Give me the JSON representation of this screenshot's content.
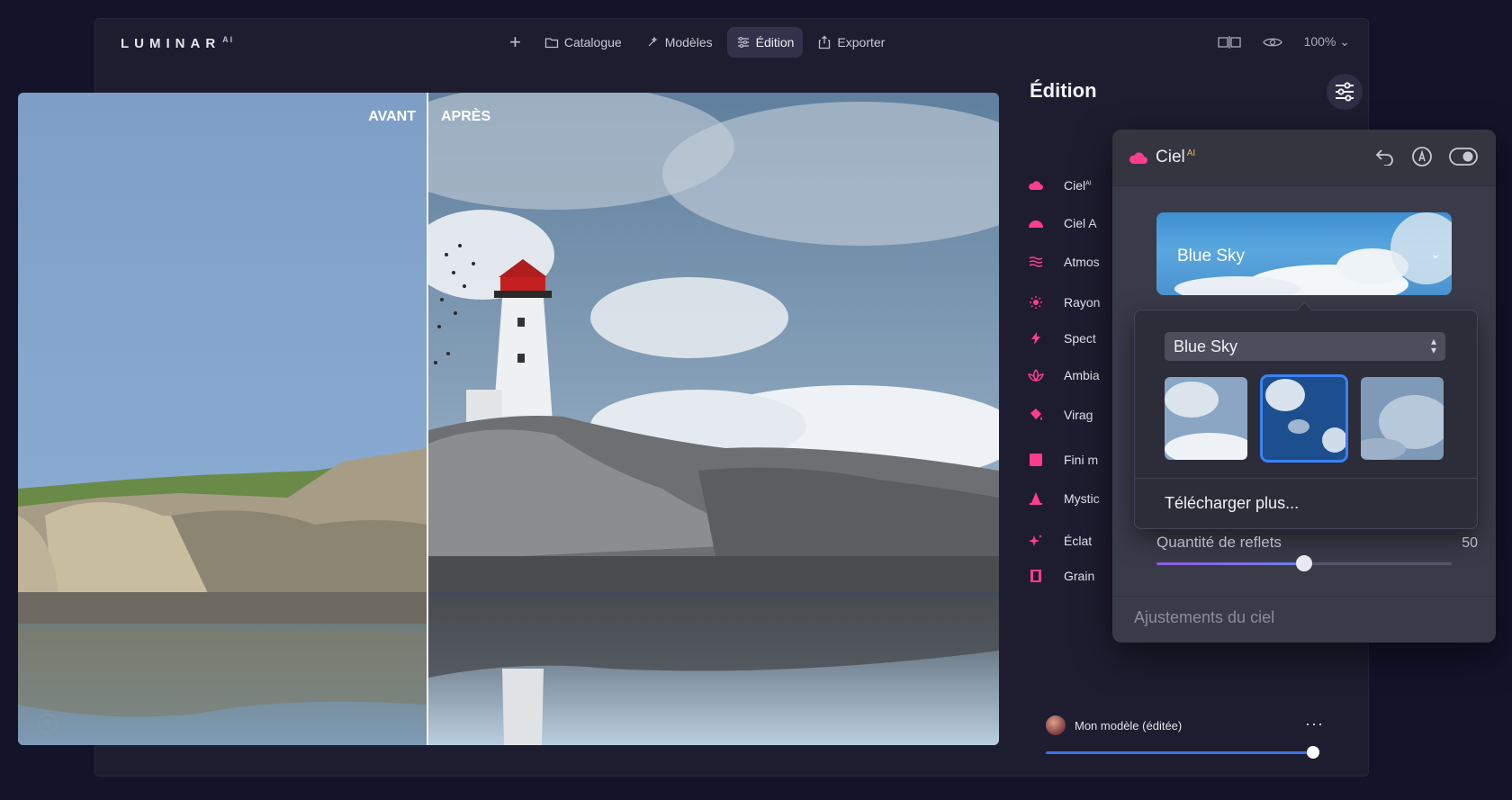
{
  "app": {
    "logo": "LUMINAR",
    "logo_sup": "AI"
  },
  "nav": {
    "plus": "+",
    "items": [
      {
        "label": "Catalogue",
        "icon": "folder-icon",
        "active": false
      },
      {
        "label": "Modèles",
        "icon": "sparkle-icon",
        "active": false
      },
      {
        "label": "Édition",
        "icon": "sliders-icon",
        "active": true
      },
      {
        "label": "Exporter",
        "icon": "export-icon",
        "active": false
      }
    ]
  },
  "toolbar_right": {
    "zoom": "100%"
  },
  "canvas": {
    "before_label": "AVANT",
    "after_label": "APRÈS",
    "copyright_icon": "©"
  },
  "panel": {
    "title": "Édition"
  },
  "tools": [
    {
      "label": "Ciel",
      "sup": "AI",
      "icon": "cloud-icon",
      "color": "#ff3d8f"
    },
    {
      "label": "Ciel A",
      "icon": "half-circle-icon",
      "color": "#ff3d8f"
    },
    {
      "label": "Atmos",
      "icon": "waves-icon",
      "color": "#ff3d8f"
    },
    {
      "label": "Rayon",
      "icon": "sun-icon",
      "color": "#ff3d8f"
    },
    {
      "label": "Spect",
      "icon": "bolt-icon",
      "color": "#ff3d8f"
    },
    {
      "label": "Ambia",
      "icon": "lotus-icon",
      "color": "#ff3d8f"
    },
    {
      "label": "Virag",
      "icon": "paint-bucket-icon",
      "color": "#ff3d8f"
    },
    {
      "label": "Fini m",
      "icon": "square-icon",
      "color": "#ff3d8f"
    },
    {
      "label": "Mystic",
      "icon": "cone-icon",
      "color": "#ff3d8f"
    },
    {
      "label": "Éclat",
      "icon": "sparkle-icon",
      "color": "#ff3d8f"
    },
    {
      "label": "Grain",
      "icon": "film-icon",
      "color": "#ff3d8f"
    }
  ],
  "model": {
    "name": "Mon modèle (éditée)",
    "more": "···",
    "amount": 100
  },
  "ciel_card": {
    "title": "Ciel",
    "title_sup": "AI",
    "icons": [
      "undo-icon",
      "erase-icon",
      "toggle-icon"
    ],
    "sky_selected": "Blue Sky",
    "popover": {
      "select_value": "Blue Sky",
      "thumbnails": [
        {
          "name": "sky-option-1",
          "selected": false
        },
        {
          "name": "sky-option-2",
          "selected": true
        },
        {
          "name": "sky-option-3",
          "selected": false
        }
      ],
      "download_label": "Télécharger plus..."
    },
    "reflection": {
      "label": "Quantité de reflets",
      "value": "50",
      "level": 0.5
    },
    "adjustments_label": "Ajustements du ciel"
  },
  "colors": {
    "accent": "#ff3d8f",
    "select_blue": "#3b82f6",
    "slider_blue": "#3d6fe0"
  }
}
